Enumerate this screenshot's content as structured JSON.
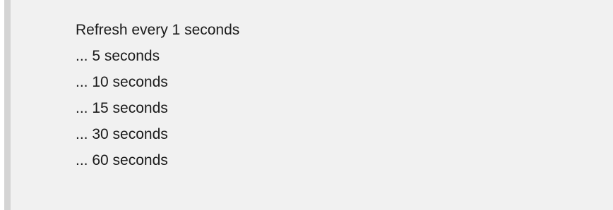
{
  "context_menu": {
    "items": [
      {
        "label": "Refresh every 1 seconds"
      },
      {
        "label": "... 5 seconds"
      },
      {
        "label": "... 10 seconds"
      },
      {
        "label": "... 15 seconds"
      },
      {
        "label": "... 30 seconds"
      },
      {
        "label": "... 60 seconds"
      }
    ]
  }
}
